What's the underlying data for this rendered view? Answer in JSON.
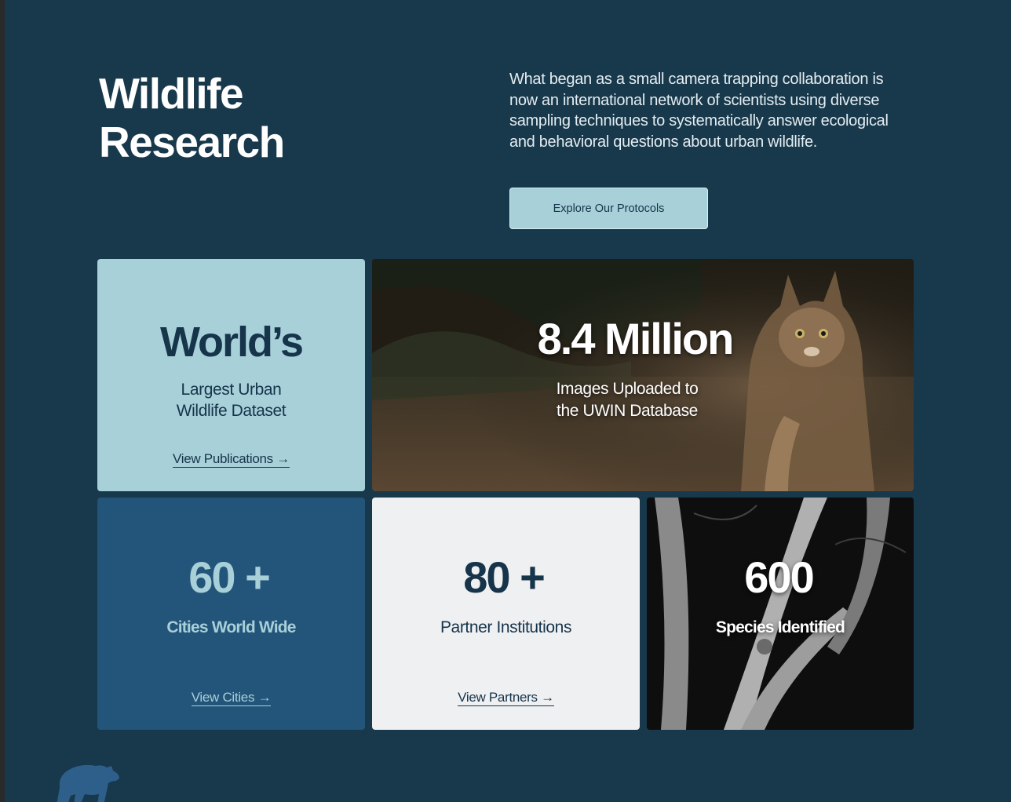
{
  "hero": {
    "title_line1": "Wildlife",
    "title_line2": "Research",
    "description": "What began as a small camera trapping collaboration is now an international network of scientists using diverse sampling techniques to systematically answer ecological and behavioral questions about urban wildlife.",
    "cta_label": "Explore Our Protocols"
  },
  "stats": {
    "worlds": {
      "headline": "World’s",
      "line1": "Largest Urban",
      "line2": "Wildlife Dataset",
      "link": "View Publications →"
    },
    "images": {
      "headline": "8.4 Million",
      "line1": "Images Uploaded to",
      "line2": "the UWIN Database",
      "photo_subject": "bobcat-photo"
    },
    "cities": {
      "headline": "60 +",
      "label": "Cities World Wide",
      "link": "View Cities →"
    },
    "partners": {
      "headline": "80 +",
      "label": "Partner Institutions",
      "link": "View Partners →"
    },
    "species": {
      "headline": "600",
      "label": "Species Identified",
      "photo_subject": "night-trees-photo"
    }
  },
  "colors": {
    "background": "#18384b",
    "light_teal": "#a8d0d9",
    "mid_blue": "#235479",
    "off_white": "#eff0f2",
    "dark_navy": "#16344a"
  },
  "footer": {
    "logo_icon": "bear-icon"
  }
}
